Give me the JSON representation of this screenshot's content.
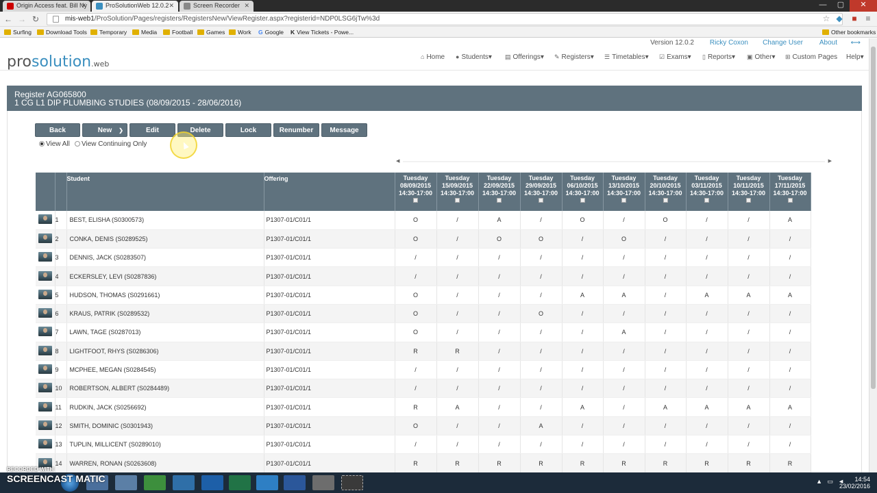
{
  "browser": {
    "tabs": [
      {
        "title": "Origin Access feat. Bill Ny",
        "favicon_color": "#cc0000"
      },
      {
        "title": "ProSolutionWeb 12.0.2",
        "favicon_color": "#3b8fbf"
      },
      {
        "title": "Screen Recorder",
        "favicon_color": "#888888"
      }
    ],
    "url_host": "mis-web1",
    "url_path": "/ProSolution/Pages/registers/RegistersNew/ViewRegister.aspx?registerid=NDP0LSG6jTw%3d",
    "bookmarks": [
      "Surfing",
      "Download Tools",
      "Temporary",
      "Media",
      "Football",
      "Games",
      "Work",
      "Google",
      "View Tickets - Powe...",
      "Other bookmarks"
    ]
  },
  "app": {
    "logo_pro": "pro",
    "logo_solution": "solution",
    "logo_web": ".web",
    "top_links": {
      "version": "Version 12.0.2",
      "user": "Ricky Coxon",
      "change_user": "Change User",
      "about": "About"
    },
    "nav": [
      "Home",
      "Students",
      "Offerings",
      "Registers",
      "Timetables",
      "Exams",
      "Reports",
      "Other",
      "Custom Pages",
      "Help"
    ]
  },
  "register": {
    "title": "Register AG065800",
    "subtitle": "1 CG L1 DIP PLUMBING STUDIES (08/09/2015 - 28/06/2016)",
    "actions": {
      "back": "Back",
      "new": "New",
      "edit": "Edit",
      "delete": "Delete",
      "lock": "Lock",
      "renumber": "Renumber",
      "message": "Message"
    },
    "view_all": "View All",
    "view_continuing": "View Continuing Only",
    "columns": {
      "student": "Student",
      "offering": "Offering"
    },
    "sessions": [
      {
        "day": "Tuesday",
        "date": "08/09/2015",
        "time": "14:30-17:00"
      },
      {
        "day": "Tuesday",
        "date": "15/09/2015",
        "time": "14:30-17:00"
      },
      {
        "day": "Tuesday",
        "date": "22/09/2015",
        "time": "14:30-17:00"
      },
      {
        "day": "Tuesday",
        "date": "29/09/2015",
        "time": "14:30-17:00"
      },
      {
        "day": "Tuesday",
        "date": "06/10/2015",
        "time": "14:30-17:00"
      },
      {
        "day": "Tuesday",
        "date": "13/10/2015",
        "time": "14:30-17:00"
      },
      {
        "day": "Tuesday",
        "date": "20/10/2015",
        "time": "14:30-17:00"
      },
      {
        "day": "Tuesday",
        "date": "03/11/2015",
        "time": "14:30-17:00"
      },
      {
        "day": "Tuesday",
        "date": "10/11/2015",
        "time": "14:30-17:00"
      },
      {
        "day": "Tuesday",
        "date": "17/11/2015",
        "time": "14:30-17:00"
      }
    ],
    "rows": [
      {
        "n": "1",
        "name": "BEST, ELISHA (S0300573)",
        "offering": "P1307-01/C01/1",
        "marks": [
          "O",
          "/",
          "A",
          "/",
          "O",
          "/",
          "O",
          "/",
          "/",
          "A"
        ]
      },
      {
        "n": "2",
        "name": "CONKA, DENIS (S0289525)",
        "offering": "P1307-01/C01/1",
        "marks": [
          "O",
          "/",
          "O",
          "O",
          "/",
          "O",
          "/",
          "/",
          "/",
          "/"
        ]
      },
      {
        "n": "3",
        "name": "DENNIS, JACK (S0283507)",
        "offering": "P1307-01/C01/1",
        "marks": [
          "/",
          "/",
          "/",
          "/",
          "/",
          "/",
          "/",
          "/",
          "/",
          "/"
        ]
      },
      {
        "n": "4",
        "name": "ECKERSLEY, LEVI (S0287836)",
        "offering": "P1307-01/C01/1",
        "marks": [
          "/",
          "/",
          "/",
          "/",
          "/",
          "/",
          "/",
          "/",
          "/",
          "/"
        ]
      },
      {
        "n": "5",
        "name": "HUDSON, THOMAS (S0291661)",
        "offering": "P1307-01/C01/1",
        "marks": [
          "O",
          "/",
          "/",
          "/",
          "A",
          "A",
          "/",
          "A",
          "A",
          "A"
        ]
      },
      {
        "n": "6",
        "name": "KRAUS, PATRIK (S0289532)",
        "offering": "P1307-01/C01/1",
        "marks": [
          "O",
          "/",
          "/",
          "O",
          "/",
          "/",
          "/",
          "/",
          "/",
          "/"
        ]
      },
      {
        "n": "7",
        "name": "LAWN, TAGE (S0287013)",
        "offering": "P1307-01/C01/1",
        "marks": [
          "O",
          "/",
          "/",
          "/",
          "/",
          "A",
          "/",
          "/",
          "/",
          "/"
        ]
      },
      {
        "n": "8",
        "name": "LIGHTFOOT, RHYS (S0286306)",
        "offering": "P1307-01/C01/1",
        "marks": [
          "R",
          "R",
          "/",
          "/",
          "/",
          "/",
          "/",
          "/",
          "/",
          "/"
        ]
      },
      {
        "n": "9",
        "name": "MCPHEE, MEGAN (S0284545)",
        "offering": "P1307-01/C01/1",
        "marks": [
          "/",
          "/",
          "/",
          "/",
          "/",
          "/",
          "/",
          "/",
          "/",
          "/"
        ]
      },
      {
        "n": "10",
        "name": "ROBERTSON, ALBERT (S0284489)",
        "offering": "P1307-01/C01/1",
        "marks": [
          "/",
          "/",
          "/",
          "/",
          "/",
          "/",
          "/",
          "/",
          "/",
          "/"
        ]
      },
      {
        "n": "11",
        "name": "RUDKIN, JACK (S0256692)",
        "offering": "P1307-01/C01/1",
        "marks": [
          "R",
          "A",
          "/",
          "/",
          "A",
          "/",
          "A",
          "A",
          "A",
          "A"
        ]
      },
      {
        "n": "12",
        "name": "SMITH, DOMINIC (S0301943)",
        "offering": "P1307-01/C01/1",
        "marks": [
          "O",
          "/",
          "/",
          "A",
          "/",
          "/",
          "/",
          "/",
          "/",
          "/"
        ]
      },
      {
        "n": "13",
        "name": "TUPLIN, MILLICENT (S0289010)",
        "offering": "P1307-01/C01/1",
        "marks": [
          "/",
          "/",
          "/",
          "/",
          "/",
          "/",
          "/",
          "/",
          "/",
          "/"
        ]
      },
      {
        "n": "14",
        "name": "WARREN, RONAN (S0263608)",
        "offering": "P1307-01/C01/1",
        "marks": [
          "R",
          "R",
          "R",
          "R",
          "R",
          "R",
          "R",
          "R",
          "R",
          "R"
        ]
      }
    ]
  },
  "taskbar": {
    "watermark_top": "RECORDED WITH",
    "watermark_big": "SCREENCAST",
    "watermark_end": "MATIC",
    "time": "14:54",
    "date": "23/02/2016"
  }
}
